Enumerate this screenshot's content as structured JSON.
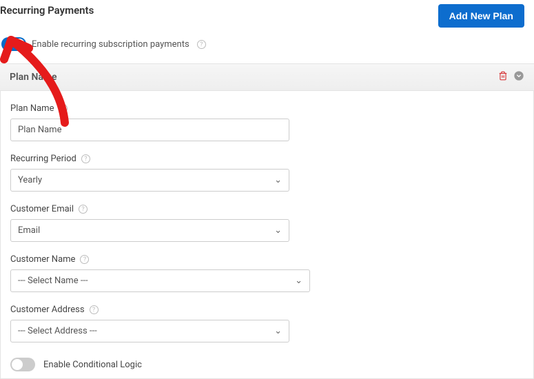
{
  "header": {
    "title": "Recurring Payments",
    "add_button": "Add New Plan"
  },
  "enable": {
    "toggle_on": true,
    "label": "Enable recurring subscription payments"
  },
  "plan": {
    "header_title": "Plan Name",
    "fields": {
      "plan_name": {
        "label": "Plan Name",
        "value": "Plan Name"
      },
      "recurring_period": {
        "label": "Recurring Period",
        "value": "Yearly"
      },
      "customer_email": {
        "label": "Customer Email",
        "value": "Email"
      },
      "customer_name": {
        "label": "Customer Name",
        "value": "--- Select Name ---"
      },
      "customer_address": {
        "label": "Customer Address",
        "value": "--- Select Address ---"
      }
    },
    "conditional": {
      "toggle_on": false,
      "label": "Enable Conditional Logic"
    }
  }
}
